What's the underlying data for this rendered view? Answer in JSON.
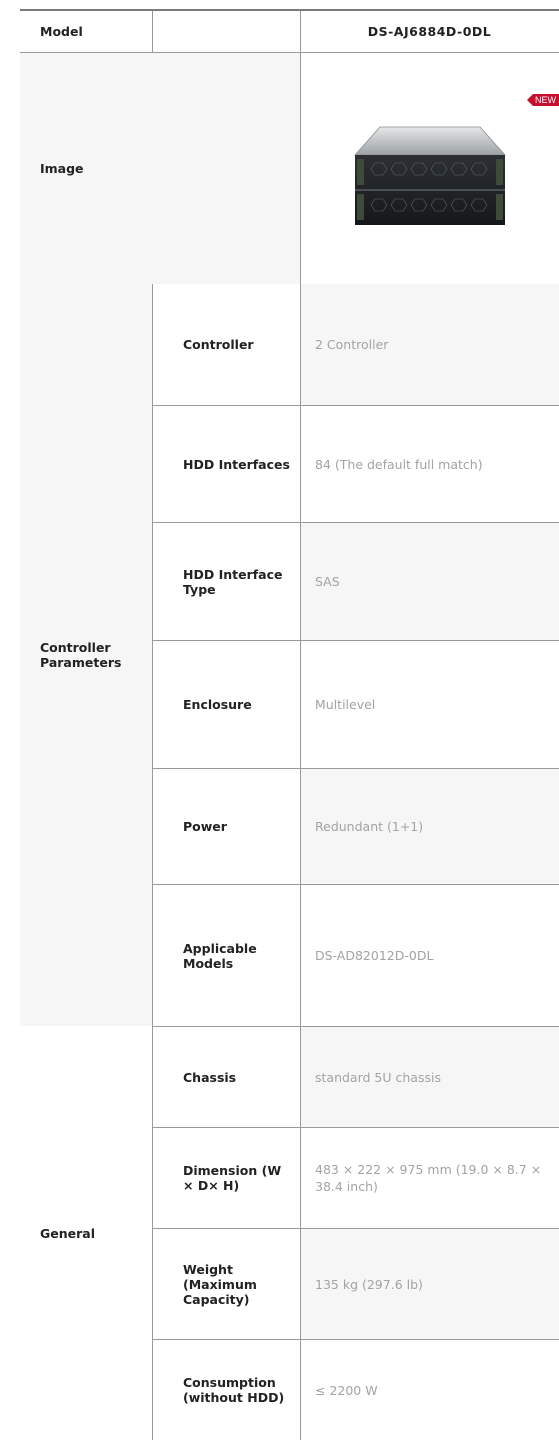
{
  "header": {
    "model_label": "Model",
    "model_value": "DS-AJ6884D-0DL"
  },
  "image_row": {
    "label": "Image",
    "badge": "NEW",
    "product_image": "storage-enclosure-5u-image"
  },
  "controller_parameters": {
    "group_label": "Controller Parameters",
    "rows": [
      {
        "label": "Controller",
        "value": "2 Controller"
      },
      {
        "label": "HDD Interfaces",
        "value": "84 (The default full match)"
      },
      {
        "label": "HDD Interface Type",
        "value": "SAS"
      },
      {
        "label": "Enclosure",
        "value": "Multilevel"
      },
      {
        "label": "Power",
        "value": "Redundant (1+1)"
      },
      {
        "label": "Applicable Models",
        "value": "DS-AD82012D-0DL"
      }
    ]
  },
  "general": {
    "group_label": "General",
    "rows": [
      {
        "label": "Chassis",
        "value": "standard 5U chassis"
      },
      {
        "label": "Dimension (W × D× H)",
        "value": "483 × 222 × 975 mm (19.0 × 8.7 × 38.4 inch)"
      },
      {
        "label": "Weight (Maximum Capacity)",
        "value": "135 kg (297.6 lb)"
      },
      {
        "label": "Consumption (without HDD)",
        "value": "≤ 2200 W"
      }
    ]
  },
  "colors": {
    "badge": "#c8102e",
    "label_bg": "#f6f6f6",
    "value_text": "#a3a3a3",
    "divider": "#9a9a9a"
  }
}
